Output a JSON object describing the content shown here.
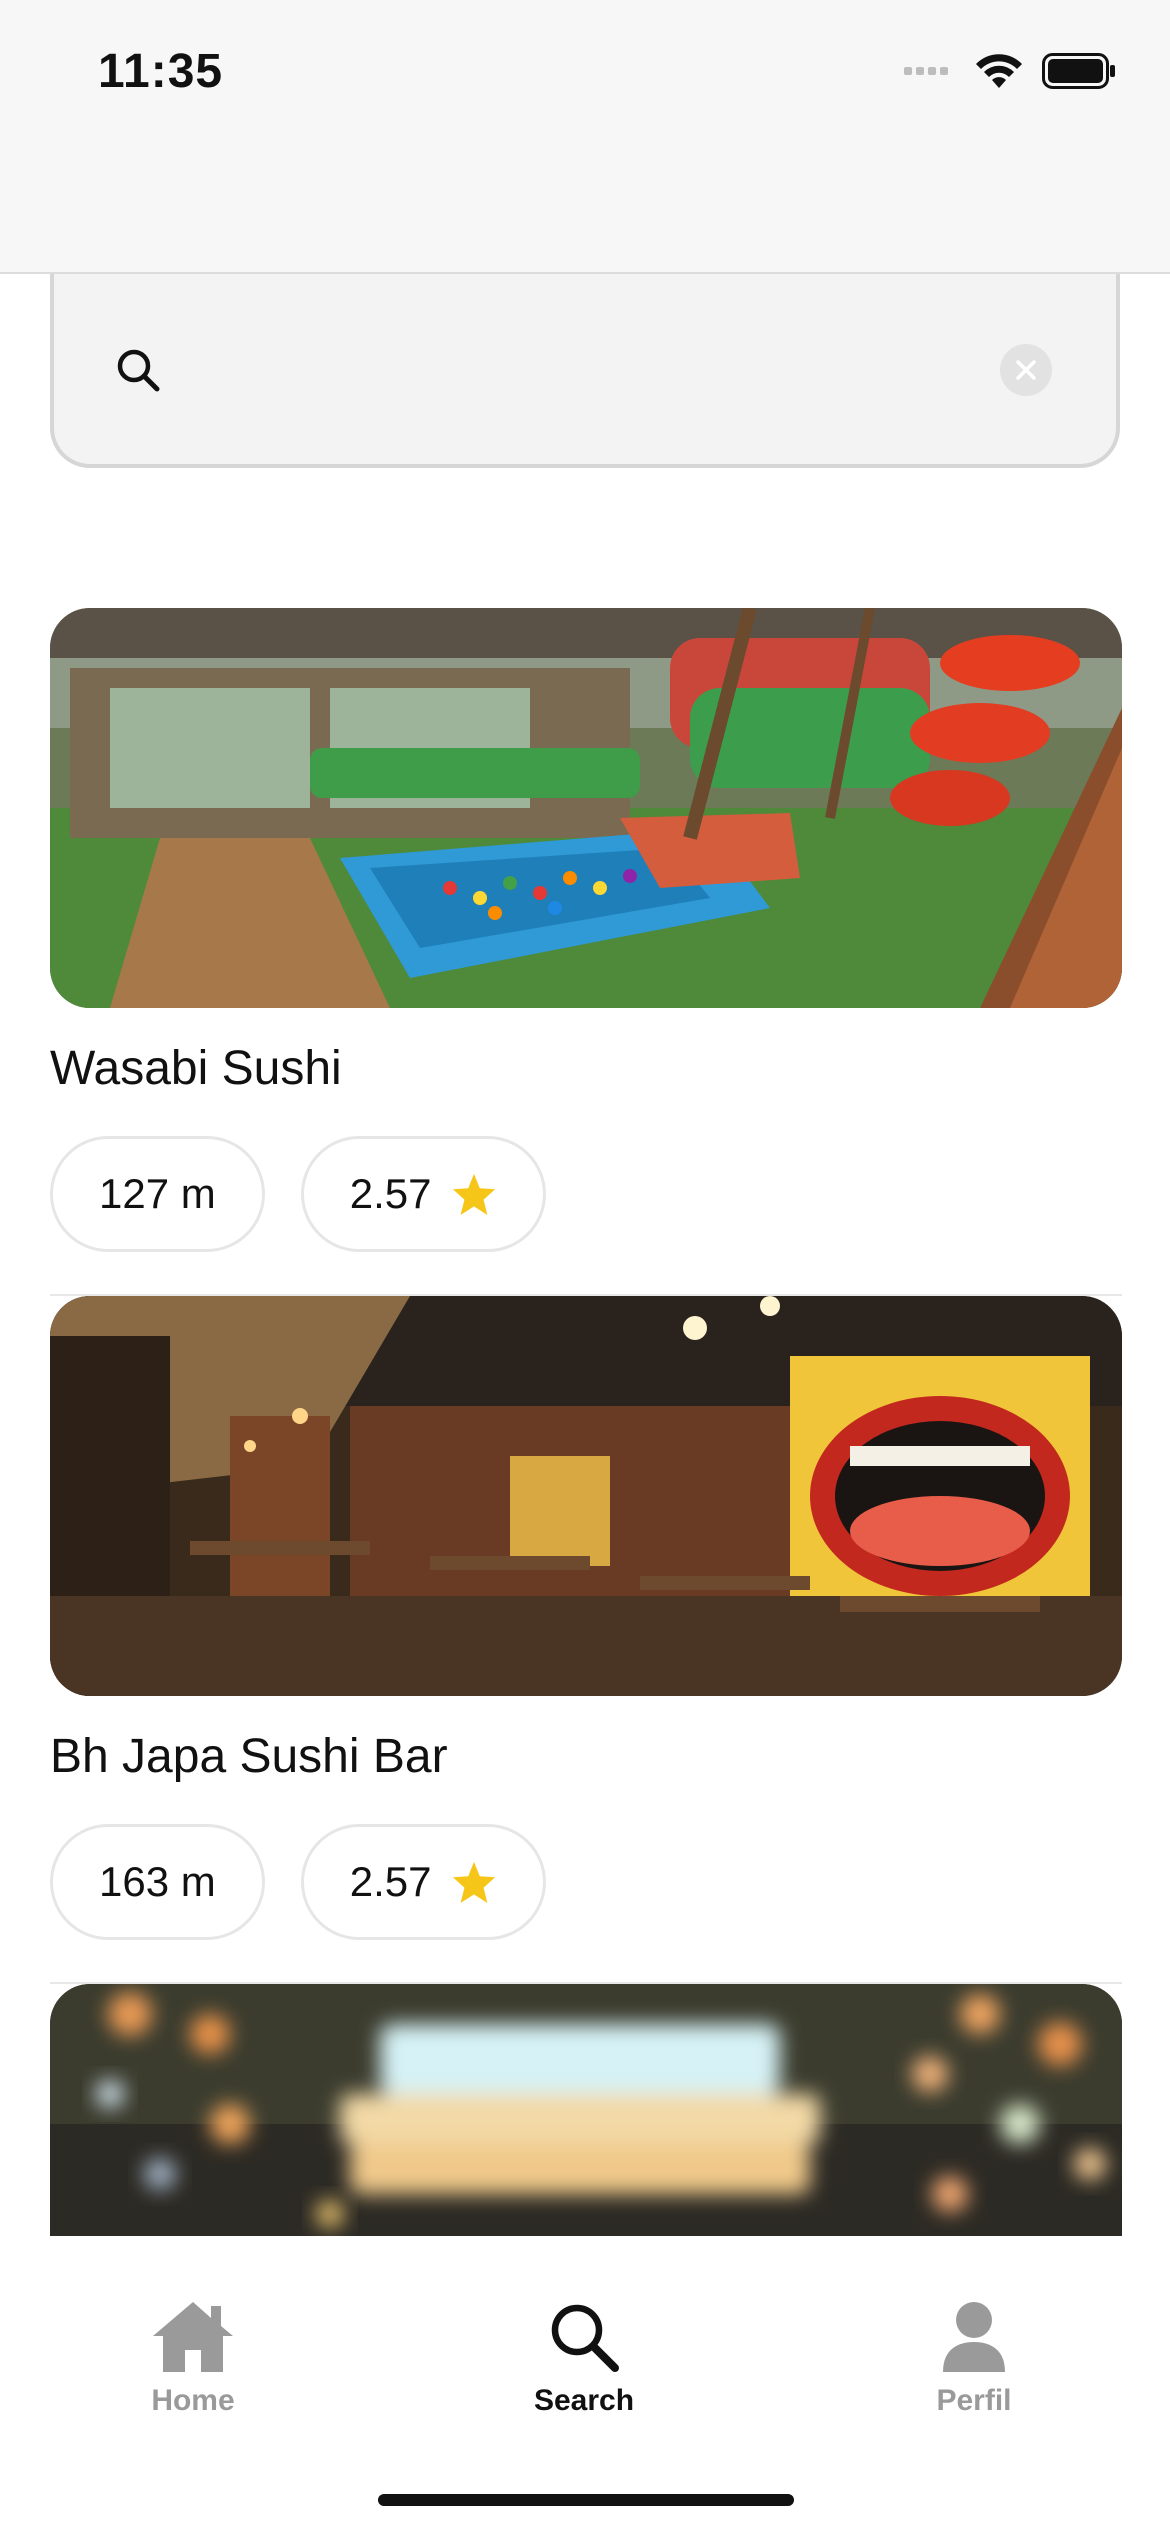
{
  "status_bar": {
    "time": "11:35"
  },
  "search": {
    "value": "",
    "placeholder": ""
  },
  "restaurants": [
    {
      "name": "Wasabi Sushi",
      "distance": "127 m",
      "rating": "2.57"
    },
    {
      "name": "Bh Japa Sushi Bar",
      "distance": "163 m",
      "rating": "2.57"
    },
    {
      "name": "",
      "distance": "",
      "rating": ""
    }
  ],
  "tab_bar": {
    "tabs": [
      {
        "label": "Home",
        "icon": "home-icon",
        "active": false
      },
      {
        "label": "Search",
        "icon": "search-icon",
        "active": true
      },
      {
        "label": "Perfil",
        "icon": "person-icon",
        "active": false
      }
    ]
  },
  "colors": {
    "star": "#f5c518",
    "active_tab": "#111111",
    "inactive_tab": "#9a9a9a"
  }
}
